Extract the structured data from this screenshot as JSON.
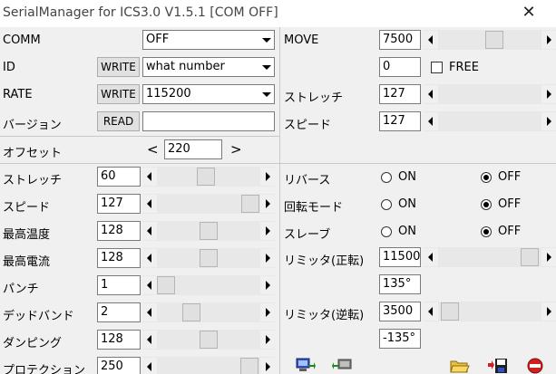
{
  "window": {
    "title": "SerialManager for ICS3.0 V1.5.1 [COM OFF]",
    "close_glyph": "✕"
  },
  "left": {
    "comm_label": "COMM",
    "comm_value": "OFF",
    "id_label": "ID",
    "id_write": "WRITE",
    "id_value": "what number",
    "rate_label": "RATE",
    "rate_write": "WRITE",
    "rate_value": "115200",
    "version_label": "バージョン",
    "version_read": "READ",
    "version_value": "",
    "offset_label": "オフセット",
    "offset_prev": "<",
    "offset_value": "220",
    "offset_next": ">"
  },
  "params": [
    {
      "label": "ストレッチ",
      "value": "60",
      "level": 0.47
    },
    {
      "label": "スピード",
      "value": "127",
      "level": 0.99
    },
    {
      "label": "最高温度",
      "value": "128",
      "level": 0.5
    },
    {
      "label": "最高電流",
      "value": "128",
      "level": 0.5
    },
    {
      "label": "パンチ",
      "value": "1",
      "level": 0.0
    },
    {
      "label": "デッドバンド",
      "value": "2",
      "level": 0.3
    },
    {
      "label": "ダンピング",
      "value": "128",
      "level": 0.5
    },
    {
      "label": "プロテクション",
      "value": "250",
      "level": 0.98
    }
  ],
  "right": {
    "move_label": "MOVE",
    "move_value": "7500",
    "move_level": 0.55,
    "offset_value": "0",
    "free_label": "FREE",
    "free_checked": false,
    "stretch_label": "ストレッチ",
    "stretch_value": "127",
    "speed_label": "スピード",
    "speed_value": "127"
  },
  "toggles": [
    {
      "label": "リバース",
      "on_label": "ON",
      "off_label": "OFF",
      "selected": "OFF"
    },
    {
      "label": "回転モード",
      "on_label": "ON",
      "off_label": "OFF",
      "selected": "OFF"
    },
    {
      "label": "スレーブ",
      "on_label": "ON",
      "off_label": "OFF",
      "selected": "OFF"
    }
  ],
  "limits": {
    "forward_label": "リミッタ(正転)",
    "forward_value": "11500",
    "forward_deg": "135°",
    "forward_level": 0.97,
    "reverse_label": "リミッタ(逆転)",
    "reverse_value": "3500",
    "reverse_deg": "-135°",
    "reverse_level": 0.03
  },
  "toolbar": [
    "monitor-write-icon",
    "monitor-read-icon",
    "open-folder-icon",
    "save-icon",
    "exit-icon"
  ]
}
